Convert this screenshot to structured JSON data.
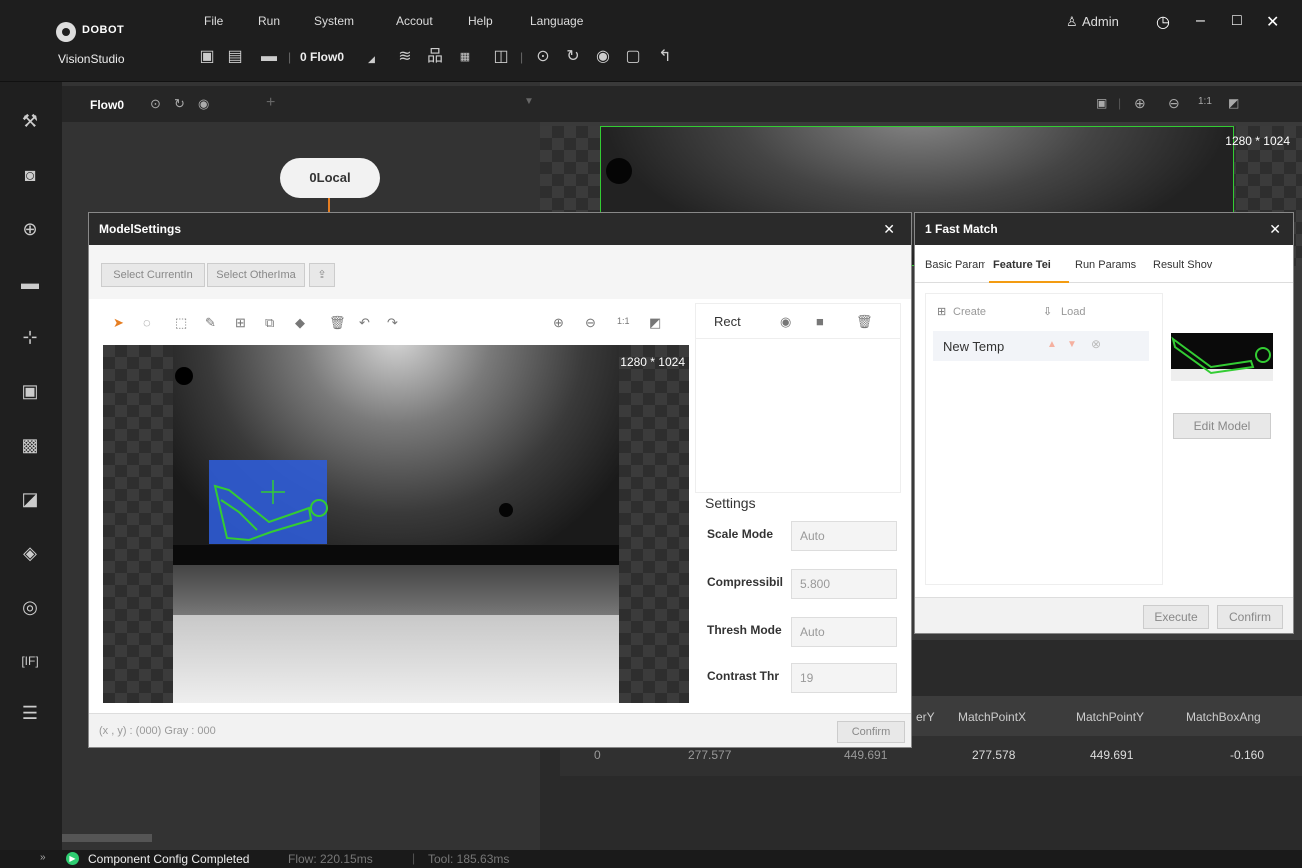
{
  "app": {
    "brand": "DOBOT",
    "subtitle": "VisionStudio"
  },
  "menu": [
    "File",
    "Run",
    "System",
    "Accout",
    "Help",
    "Language"
  ],
  "toolbar": {
    "flow_select": "0 Flow0"
  },
  "user": {
    "name": "Admin"
  },
  "flow": {
    "tab": "Flow0",
    "node": "0Local"
  },
  "image_view": {
    "resolution": "1280 * 1024"
  },
  "model_settings": {
    "title": "ModelSettings",
    "btn_current": "Select CurrentIn",
    "btn_other": "Select OtherIma",
    "resolution": "1280 * 1024",
    "shape_label": "Rect",
    "settings_title": "Settings",
    "fields": [
      {
        "label": "Scale Mode",
        "value": "Auto"
      },
      {
        "label": "Compressibil",
        "value": "5.800"
      },
      {
        "label": "Thresh Mode",
        "value": "Auto"
      },
      {
        "label": "Contrast Thr",
        "value": "19"
      }
    ],
    "coords": "(x , y) : (000) Gray : 000",
    "confirm": "Confirm"
  },
  "fast_match": {
    "title": "1 Fast Match",
    "tabs": [
      "Basic Param",
      "Feature Tei",
      "Run Params",
      "Result Shov"
    ],
    "create": "Create",
    "load": "Load",
    "template": "New Temp",
    "edit_model": "Edit Model",
    "execute": "Execute",
    "confirm": "Confirm"
  },
  "results": {
    "headers": [
      "erY",
      "MatchPointX",
      "MatchPointY",
      "MatchBoxAng"
    ],
    "row": [
      "0",
      "277.577",
      "449.691",
      "277.578",
      "449.691",
      "-0.160"
    ]
  },
  "status": {
    "message": "Component Config Completed",
    "flow": "Flow: 220.15ms",
    "tool": "Tool: 185.63ms"
  },
  "colors": {
    "accent": "#f39c12",
    "match_green": "#33cc33",
    "roi_blue": "#2f5cd6"
  }
}
